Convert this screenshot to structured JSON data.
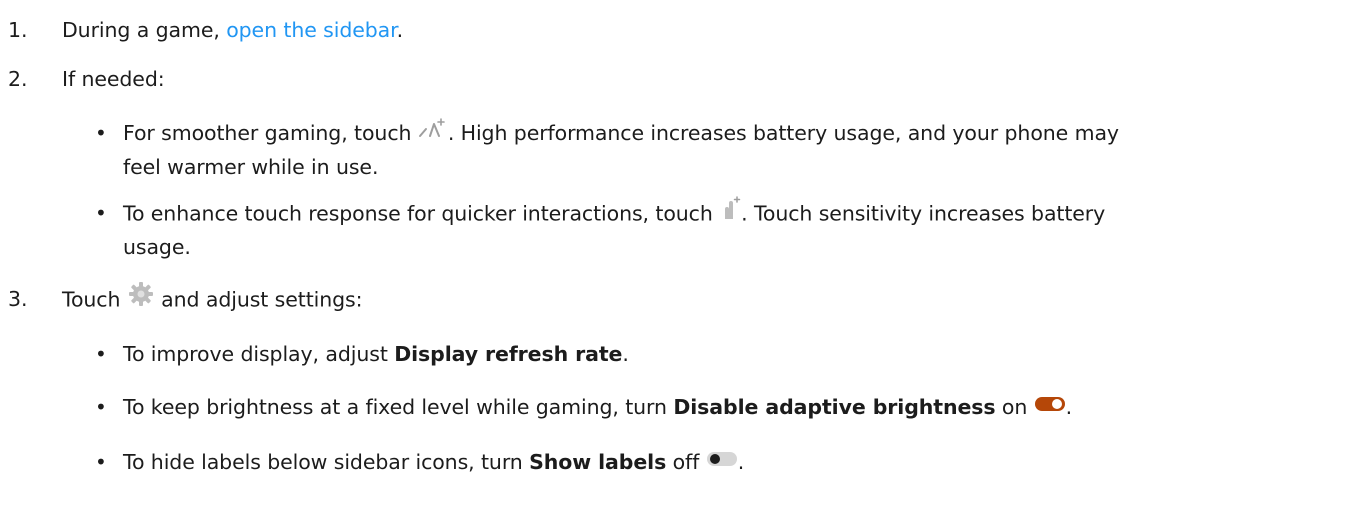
{
  "steps": [
    {
      "number": "1.",
      "prefix": "During a game, ",
      "link": "open the sidebar",
      "suffix": "."
    },
    {
      "number": "2.",
      "text": "If needed:",
      "bullets": [
        {
          "before": "For smoother gaming, touch ",
          "icon": "high-performance-icon",
          "after": ". High performance increases battery usage, and your phone may",
          "continuation": "feel warmer while in use."
        },
        {
          "before": "To enhance touch response for quicker interactions, touch ",
          "icon": "touch-sensitivity-icon",
          "after": ". Touch sensitivity increases battery",
          "continuation": "usage."
        }
      ]
    },
    {
      "number": "3.",
      "before": "Touch ",
      "icon": "gear-icon",
      "after": " and adjust settings:",
      "bullets": [
        {
          "before": "To improve display, adjust ",
          "bold": "Display refresh rate",
          "after": "."
        },
        {
          "before": "To keep brightness at a fixed level while gaming, turn ",
          "bold": "Disable adaptive brightness",
          "middle": " on ",
          "icon": "toggle-on-icon",
          "after": "."
        },
        {
          "before": "To hide labels below sidebar icons, turn ",
          "bold": "Show labels",
          "middle": " off ",
          "icon": "toggle-off-icon",
          "after": "."
        }
      ]
    }
  ],
  "bullet_char": "•",
  "colors": {
    "text": "#1c1c1c",
    "link": "#2196f3",
    "toggle_on": "#b54708",
    "icon_gray": "#9e9e9e"
  }
}
